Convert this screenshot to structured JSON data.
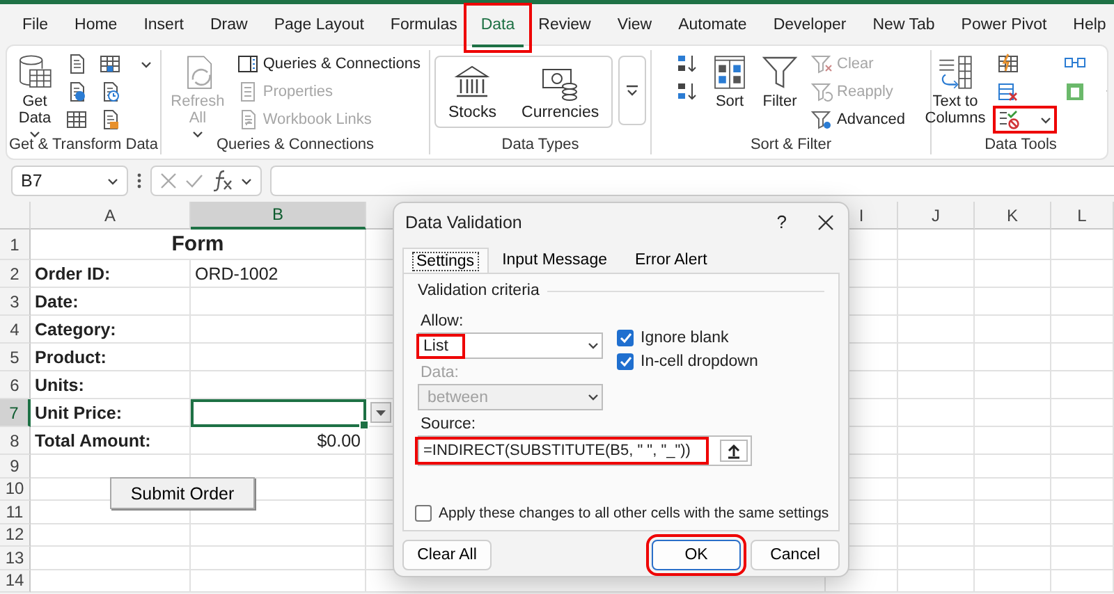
{
  "ribbon_tabs": [
    {
      "label": "File",
      "selected": false
    },
    {
      "label": "Home",
      "selected": false
    },
    {
      "label": "Insert",
      "selected": false
    },
    {
      "label": "Draw",
      "selected": false
    },
    {
      "label": "Page Layout",
      "selected": false
    },
    {
      "label": "Formulas",
      "selected": false
    },
    {
      "label": "Data",
      "selected": true,
      "highlighted": true
    },
    {
      "label": "Review",
      "selected": false
    },
    {
      "label": "View",
      "selected": false
    },
    {
      "label": "Automate",
      "selected": false
    },
    {
      "label": "Developer",
      "selected": false
    },
    {
      "label": "New Tab",
      "selected": false
    },
    {
      "label": "Power Pivot",
      "selected": false
    },
    {
      "label": "Help",
      "selected": false
    }
  ],
  "ribbon_groups": [
    {
      "label": "Get & Transform Data",
      "items": [
        {
          "kind": "large",
          "label": "Get Data",
          "dropdown": true,
          "disabled": false
        },
        {
          "kind": "icon",
          "dropdown": false,
          "disabled": false
        },
        {
          "kind": "icon",
          "dropdown": false,
          "disabled": false
        },
        {
          "kind": "icon",
          "dropdown": false,
          "disabled": false
        },
        {
          "kind": "icon",
          "dropdown": true,
          "disabled": false
        },
        {
          "kind": "icon",
          "dropdown": false,
          "disabled": false
        },
        {
          "kind": "icon",
          "dropdown": false,
          "disabled": false
        }
      ]
    },
    {
      "label": "Queries & Connections",
      "items": [
        {
          "kind": "large",
          "label": "Refresh All",
          "dropdown": true,
          "disabled": true
        },
        {
          "kind": "small",
          "label": "Queries & Connections",
          "dropdown": false,
          "disabled": false
        },
        {
          "kind": "small",
          "label": "Properties",
          "dropdown": false,
          "disabled": true
        },
        {
          "kind": "small",
          "label": "Workbook Links",
          "dropdown": false,
          "disabled": true
        }
      ]
    },
    {
      "label": "Data Types",
      "items": [
        {
          "kind": "gallery",
          "options": [
            "Stocks",
            "Currencies"
          ]
        }
      ]
    },
    {
      "label": "Sort & Filter",
      "items": [
        {
          "kind": "icon",
          "dropdown": false,
          "disabled": false
        },
        {
          "kind": "icon",
          "dropdown": false,
          "disabled": false
        },
        {
          "kind": "large",
          "label": "Sort",
          "dropdown": false,
          "disabled": false
        },
        {
          "kind": "large",
          "label": "Filter",
          "dropdown": false,
          "disabled": false
        },
        {
          "kind": "small",
          "label": "Clear",
          "dropdown": false,
          "disabled": true
        },
        {
          "kind": "small",
          "label": "Reapply",
          "dropdown": false,
          "disabled": true
        },
        {
          "kind": "small",
          "label": "Advanced",
          "dropdown": false,
          "disabled": false
        }
      ]
    },
    {
      "label": "Data Tools",
      "items": [
        {
          "kind": "large",
          "label": "Text to Columns",
          "dropdown": false,
          "disabled": false
        },
        {
          "kind": "icon",
          "dropdown": false,
          "disabled": false
        },
        {
          "kind": "icon",
          "dropdown": false,
          "disabled": false
        },
        {
          "kind": "icon",
          "dropdown": true,
          "disabled": false,
          "highlighted": true
        },
        {
          "kind": "icon",
          "dropdown": false,
          "disabled": false
        },
        {
          "kind": "icon",
          "dropdown": true,
          "disabled": false
        }
      ]
    }
  ],
  "formula_bar": {
    "name_box": "B7"
  },
  "sheet": {
    "columns": [
      {
        "label": "A",
        "selected": false
      },
      {
        "label": "B",
        "selected": true
      },
      {
        "label": "I",
        "selected": false
      },
      {
        "label": "J",
        "selected": false
      },
      {
        "label": "K",
        "selected": false
      },
      {
        "label": "L",
        "selected": false
      }
    ],
    "rows": [
      {
        "number": "1",
        "kind": "title",
        "title": "Form",
        "selected": false
      },
      {
        "number": "2",
        "kind": "field",
        "label": "Order ID:",
        "value": "ORD-1002",
        "selected": false
      },
      {
        "number": "3",
        "kind": "field",
        "label": "Date:",
        "selected": false
      },
      {
        "number": "4",
        "kind": "field",
        "label": "Category:",
        "selected": false
      },
      {
        "number": "5",
        "kind": "field",
        "label": "Product:",
        "selected": false
      },
      {
        "number": "6",
        "kind": "field",
        "label": "Units:",
        "selected": false
      },
      {
        "number": "7",
        "kind": "field",
        "label": "Unit Price:",
        "selected": true
      },
      {
        "number": "8",
        "kind": "amount",
        "label": "Total Amount:",
        "value": "$0.00",
        "selected": false
      },
      {
        "number": "9",
        "kind": "blank",
        "selected": false
      },
      {
        "number": "10",
        "kind": "blank",
        "selected": false
      },
      {
        "number": "11",
        "kind": "blank",
        "selected": false
      },
      {
        "number": "12",
        "kind": "blank",
        "selected": false
      },
      {
        "number": "13",
        "kind": "blank",
        "selected": false
      },
      {
        "number": "14",
        "kind": "blank",
        "selected": false
      }
    ],
    "form_button": {
      "label": "Submit Order"
    }
  },
  "dialog": {
    "title": "Data Validation",
    "help_label": "?",
    "tabs": [
      {
        "label": "Settings",
        "selected": true
      },
      {
        "label": "Input Message",
        "selected": false
      },
      {
        "label": "Error Alert",
        "selected": false
      }
    ],
    "section_title": "Validation criteria",
    "allow": {
      "label": "Allow:",
      "value": "List",
      "highlighted": true
    },
    "checkboxes": [
      {
        "label": "Ignore blank",
        "checked": true
      },
      {
        "label": "In-cell dropdown",
        "checked": true
      }
    ],
    "data": {
      "label": "Data:",
      "value": "between",
      "disabled": true
    },
    "source": {
      "label": "Source:",
      "value": "=INDIRECT(SUBSTITUTE(B5, \" \", \"_\"))",
      "highlighted": true
    },
    "apply_all": {
      "label": "Apply these changes to all other cells with the same settings",
      "checked": false
    },
    "buttons": [
      {
        "label": "Clear All",
        "highlighted": false,
        "default": false
      },
      {
        "label": "OK",
        "highlighted": true,
        "default": true
      },
      {
        "label": "Cancel",
        "highlighted": false,
        "default": false
      }
    ]
  }
}
